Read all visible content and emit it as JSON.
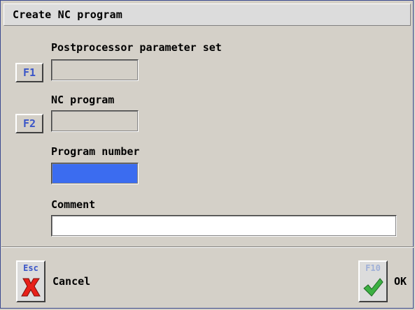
{
  "dialog": {
    "title": "Create NC program"
  },
  "fields": {
    "postprocessor": {
      "label": "Postprocessor parameter set",
      "key": "F1",
      "value": ""
    },
    "nc_program": {
      "label": "NC program",
      "key": "F2",
      "value": ""
    },
    "program_number": {
      "label": "Program number",
      "value": ""
    },
    "comment": {
      "label": "Comment",
      "value": ""
    }
  },
  "buttons": {
    "cancel": {
      "key": "Esc",
      "label": "Cancel",
      "icon": "red-x-icon"
    },
    "ok": {
      "key": "F10",
      "label": "OK",
      "icon": "green-check-icon"
    }
  },
  "colors": {
    "accent_blue": "#3b6cf0",
    "key_text_blue": "#3a55c8",
    "cancel_red": "#e8201a",
    "ok_green": "#3cb043"
  }
}
